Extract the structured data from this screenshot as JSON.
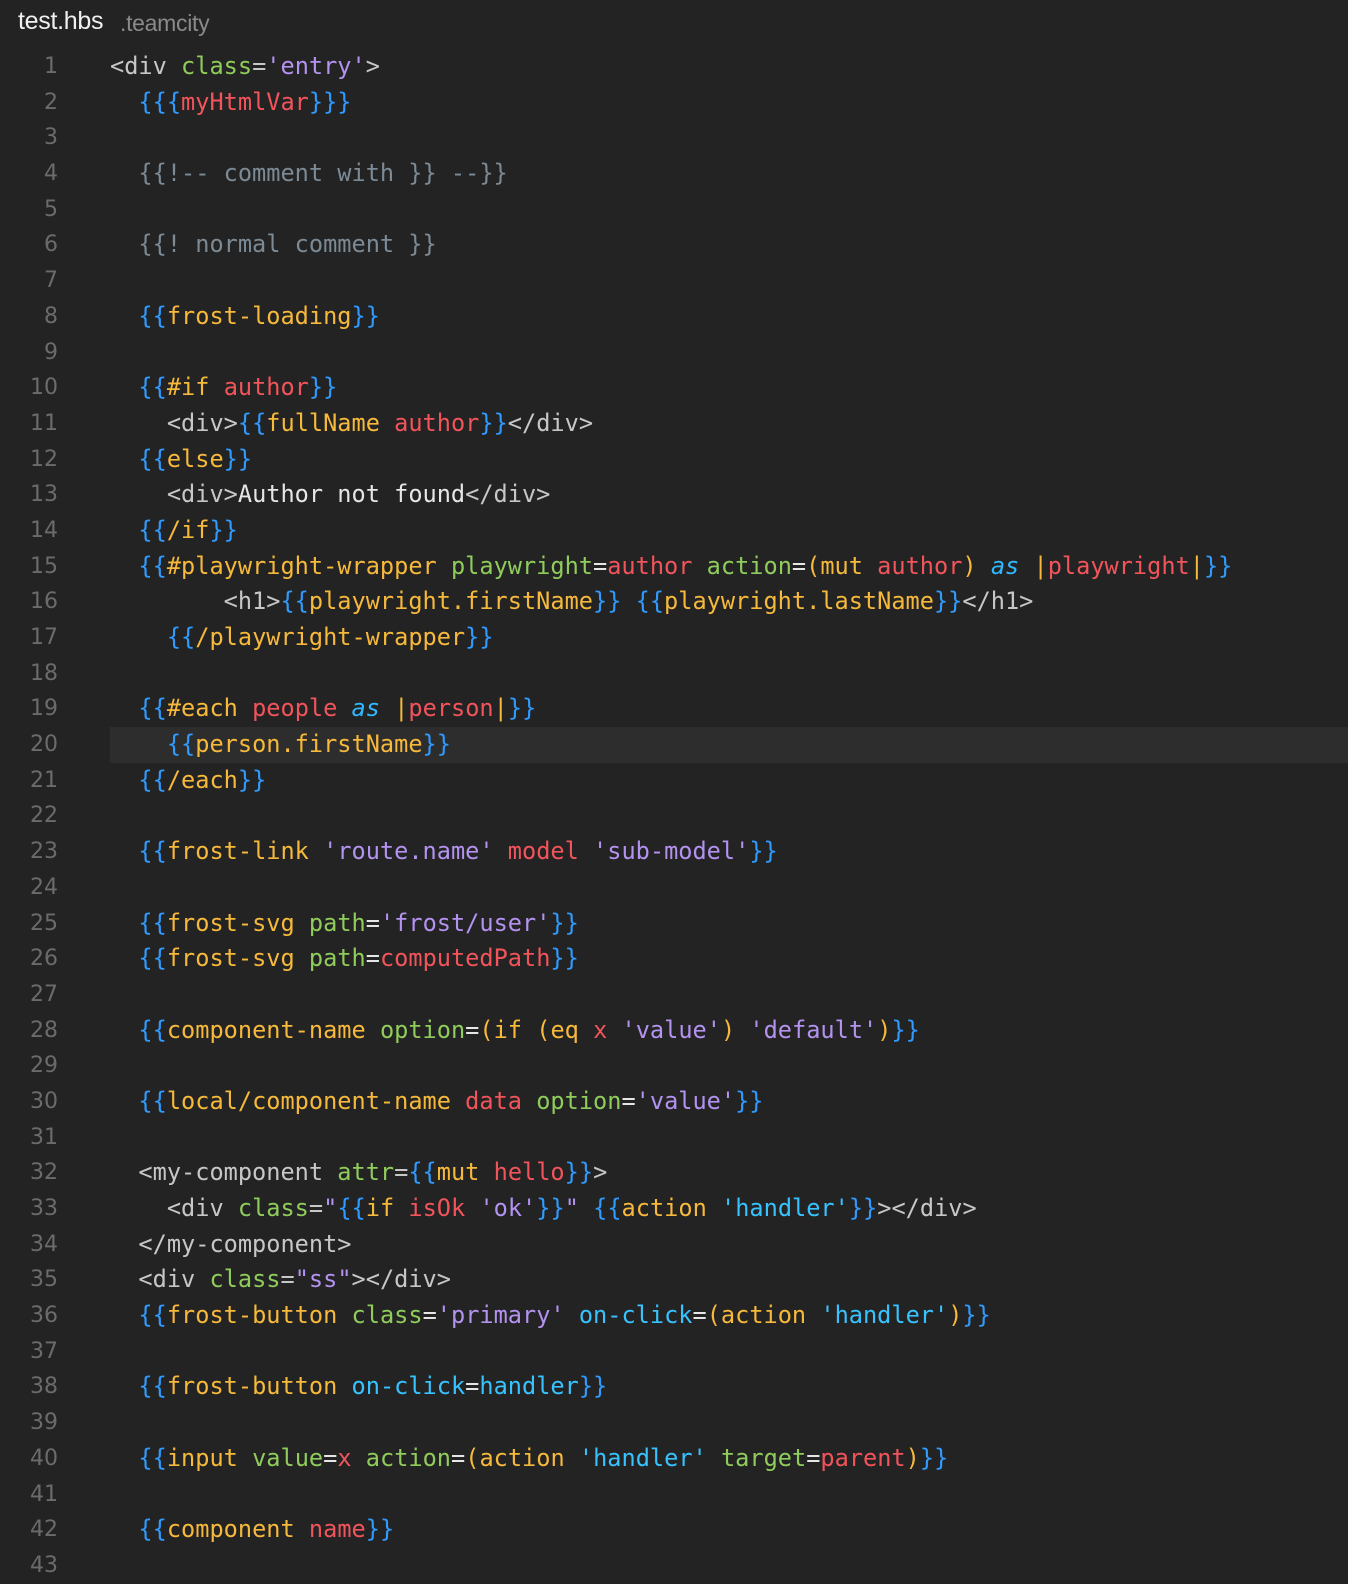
{
  "tab": {
    "filename": "test.hbs",
    "suffix": ".teamcity"
  },
  "editor": {
    "current_line": 20,
    "colors": {
      "background": "#232323",
      "line_number": "#6b6b6b",
      "current_line_highlight": "#2d2d2d",
      "brace": "#2f9bff",
      "helper": "#f6b93b",
      "attribute": "#8fcc5b",
      "variable": "#f2545b",
      "string": "#b392f0",
      "comment": "#7b8a95",
      "keyword": "#2fb8ff",
      "tag": "#c7c7c7"
    }
  },
  "lines": [
    {
      "n": "1",
      "tokens": [
        [
          "tag",
          "<div "
        ],
        [
          "attr",
          "class"
        ],
        [
          "tag",
          "="
        ],
        [
          "str",
          "'entry'"
        ],
        [
          "tag",
          ">"
        ]
      ]
    },
    {
      "n": "2",
      "tokens": [
        [
          "plain",
          "  "
        ],
        [
          "brace",
          "{{{"
        ],
        [
          "var",
          "myHtmlVar"
        ],
        [
          "brace",
          "}}}"
        ]
      ]
    },
    {
      "n": "3",
      "tokens": []
    },
    {
      "n": "4",
      "tokens": [
        [
          "plain",
          "  "
        ],
        [
          "comment",
          "{{!-- comment with }} --}}"
        ]
      ]
    },
    {
      "n": "5",
      "tokens": []
    },
    {
      "n": "6",
      "tokens": [
        [
          "plain",
          "  "
        ],
        [
          "comment",
          "{{! normal comment }}"
        ]
      ]
    },
    {
      "n": "7",
      "tokens": []
    },
    {
      "n": "8",
      "tokens": [
        [
          "plain",
          "  "
        ],
        [
          "brace",
          "{{"
        ],
        [
          "helper",
          "frost-loading"
        ],
        [
          "brace",
          "}}"
        ]
      ]
    },
    {
      "n": "9",
      "tokens": []
    },
    {
      "n": "10",
      "tokens": [
        [
          "plain",
          "  "
        ],
        [
          "brace",
          "{{"
        ],
        [
          "helper",
          "#if"
        ],
        [
          "plain",
          " "
        ],
        [
          "var",
          "author"
        ],
        [
          "brace",
          "}}"
        ]
      ]
    },
    {
      "n": "11",
      "tokens": [
        [
          "plain",
          "    "
        ],
        [
          "tag",
          "<div>"
        ],
        [
          "brace",
          "{{"
        ],
        [
          "helper",
          "fullName"
        ],
        [
          "plain",
          " "
        ],
        [
          "var",
          "author"
        ],
        [
          "brace",
          "}}"
        ],
        [
          "tag",
          "</div>"
        ]
      ]
    },
    {
      "n": "12",
      "tokens": [
        [
          "plain",
          "  "
        ],
        [
          "brace",
          "{{"
        ],
        [
          "helper",
          "else"
        ],
        [
          "brace",
          "}}"
        ]
      ]
    },
    {
      "n": "13",
      "tokens": [
        [
          "plain",
          "    "
        ],
        [
          "tag",
          "<div>"
        ],
        [
          "plain",
          "Author not found"
        ],
        [
          "tag",
          "</div>"
        ]
      ]
    },
    {
      "n": "14",
      "tokens": [
        [
          "plain",
          "  "
        ],
        [
          "brace",
          "{{"
        ],
        [
          "helper",
          "/if"
        ],
        [
          "brace",
          "}}"
        ]
      ]
    },
    {
      "n": "15",
      "tokens": [
        [
          "plain",
          "  "
        ],
        [
          "brace",
          "{{"
        ],
        [
          "helper",
          "#playwright-wrapper"
        ],
        [
          "plain",
          " "
        ],
        [
          "attr",
          "playwright"
        ],
        [
          "plain",
          "="
        ],
        [
          "var",
          "author"
        ],
        [
          "plain",
          " "
        ],
        [
          "attr",
          "action"
        ],
        [
          "plain",
          "="
        ],
        [
          "helper",
          "(mut"
        ],
        [
          "plain",
          " "
        ],
        [
          "var",
          "author"
        ],
        [
          "helper",
          ")"
        ],
        [
          "plain",
          " "
        ],
        [
          "kw",
          "as"
        ],
        [
          "plain",
          " "
        ],
        [
          "pipe",
          "|"
        ],
        [
          "var",
          "playwright"
        ],
        [
          "pipe",
          "|"
        ],
        [
          "brace",
          "}}"
        ]
      ]
    },
    {
      "n": "16",
      "tokens": [
        [
          "plain",
          "        "
        ],
        [
          "tag",
          "<h1>"
        ],
        [
          "brace",
          "{{"
        ],
        [
          "helper",
          "playwright.firstName"
        ],
        [
          "brace",
          "}}"
        ],
        [
          "plain",
          " "
        ],
        [
          "brace",
          "{{"
        ],
        [
          "helper",
          "playwright.lastName"
        ],
        [
          "brace",
          "}}"
        ],
        [
          "tag",
          "</h1>"
        ]
      ]
    },
    {
      "n": "17",
      "tokens": [
        [
          "plain",
          "    "
        ],
        [
          "brace",
          "{{"
        ],
        [
          "helper",
          "/playwright-wrapper"
        ],
        [
          "brace",
          "}}"
        ]
      ]
    },
    {
      "n": "18",
      "tokens": []
    },
    {
      "n": "19",
      "tokens": [
        [
          "plain",
          "  "
        ],
        [
          "brace",
          "{{"
        ],
        [
          "helper",
          "#each"
        ],
        [
          "plain",
          " "
        ],
        [
          "var",
          "people"
        ],
        [
          "plain",
          " "
        ],
        [
          "kw",
          "as"
        ],
        [
          "plain",
          " "
        ],
        [
          "pipe",
          "|"
        ],
        [
          "var",
          "person"
        ],
        [
          "pipe",
          "|"
        ],
        [
          "brace",
          "}}"
        ]
      ]
    },
    {
      "n": "20",
      "tokens": [
        [
          "plain",
          "    "
        ],
        [
          "brace",
          "{{"
        ],
        [
          "helper",
          "person.firstName"
        ],
        [
          "brace",
          "}}"
        ]
      ]
    },
    {
      "n": "21",
      "tokens": [
        [
          "plain",
          "  "
        ],
        [
          "brace",
          "{{"
        ],
        [
          "helper",
          "/each"
        ],
        [
          "brace",
          "}}"
        ]
      ]
    },
    {
      "n": "22",
      "tokens": []
    },
    {
      "n": "23",
      "tokens": [
        [
          "plain",
          "  "
        ],
        [
          "brace",
          "{{"
        ],
        [
          "helper",
          "frost-link"
        ],
        [
          "plain",
          " "
        ],
        [
          "str",
          "'route.name'"
        ],
        [
          "plain",
          " "
        ],
        [
          "var",
          "model"
        ],
        [
          "plain",
          " "
        ],
        [
          "str",
          "'sub-model'"
        ],
        [
          "brace",
          "}}"
        ]
      ]
    },
    {
      "n": "24",
      "tokens": []
    },
    {
      "n": "25",
      "tokens": [
        [
          "plain",
          "  "
        ],
        [
          "brace",
          "{{"
        ],
        [
          "helper",
          "frost-svg"
        ],
        [
          "plain",
          " "
        ],
        [
          "attr",
          "path"
        ],
        [
          "plain",
          "="
        ],
        [
          "str",
          "'frost/user'"
        ],
        [
          "brace",
          "}}"
        ]
      ]
    },
    {
      "n": "26",
      "tokens": [
        [
          "plain",
          "  "
        ],
        [
          "brace",
          "{{"
        ],
        [
          "helper",
          "frost-svg"
        ],
        [
          "plain",
          " "
        ],
        [
          "attr",
          "path"
        ],
        [
          "plain",
          "="
        ],
        [
          "var",
          "computedPath"
        ],
        [
          "brace",
          "}}"
        ]
      ]
    },
    {
      "n": "27",
      "tokens": []
    },
    {
      "n": "28",
      "tokens": [
        [
          "plain",
          "  "
        ],
        [
          "brace",
          "{{"
        ],
        [
          "helper",
          "component-name"
        ],
        [
          "plain",
          " "
        ],
        [
          "attr",
          "option"
        ],
        [
          "plain",
          "="
        ],
        [
          "helper",
          "(if"
        ],
        [
          "plain",
          " "
        ],
        [
          "helper",
          "(eq"
        ],
        [
          "plain",
          " "
        ],
        [
          "var",
          "x"
        ],
        [
          "plain",
          " "
        ],
        [
          "str",
          "'value'"
        ],
        [
          "helper",
          ")"
        ],
        [
          "plain",
          " "
        ],
        [
          "str",
          "'default'"
        ],
        [
          "helper",
          ")"
        ],
        [
          "brace",
          "}}"
        ]
      ]
    },
    {
      "n": "29",
      "tokens": []
    },
    {
      "n": "30",
      "tokens": [
        [
          "plain",
          "  "
        ],
        [
          "brace",
          "{{"
        ],
        [
          "helper",
          "local/component-name"
        ],
        [
          "plain",
          " "
        ],
        [
          "var",
          "data"
        ],
        [
          "plain",
          " "
        ],
        [
          "attr",
          "option"
        ],
        [
          "plain",
          "="
        ],
        [
          "str",
          "'value'"
        ],
        [
          "brace",
          "}}"
        ]
      ]
    },
    {
      "n": "31",
      "tokens": []
    },
    {
      "n": "32",
      "tokens": [
        [
          "plain",
          "  "
        ],
        [
          "tag",
          "<my-component "
        ],
        [
          "attr",
          "attr"
        ],
        [
          "tag",
          "="
        ],
        [
          "brace",
          "{{"
        ],
        [
          "helper",
          "mut"
        ],
        [
          "plain",
          " "
        ],
        [
          "var",
          "hello"
        ],
        [
          "brace",
          "}}"
        ],
        [
          "tag",
          ">"
        ]
      ]
    },
    {
      "n": "33",
      "tokens": [
        [
          "plain",
          "    "
        ],
        [
          "tag",
          "<div "
        ],
        [
          "attr",
          "class"
        ],
        [
          "tag",
          "="
        ],
        [
          "str",
          "\""
        ],
        [
          "brace",
          "{{"
        ],
        [
          "helper",
          "if"
        ],
        [
          "plain",
          " "
        ],
        [
          "var",
          "isOk"
        ],
        [
          "plain",
          " "
        ],
        [
          "str",
          "'ok'"
        ],
        [
          "brace",
          "}}"
        ],
        [
          "str",
          "\""
        ],
        [
          "plain",
          " "
        ],
        [
          "brace",
          "{{"
        ],
        [
          "helper",
          "action"
        ],
        [
          "plain",
          " "
        ],
        [
          "handler",
          "'handler'"
        ],
        [
          "brace",
          "}}"
        ],
        [
          "tag",
          "></div>"
        ]
      ]
    },
    {
      "n": "34",
      "tokens": [
        [
          "plain",
          "  "
        ],
        [
          "tag",
          "</my-component>"
        ]
      ]
    },
    {
      "n": "35",
      "tokens": [
        [
          "plain",
          "  "
        ],
        [
          "tag",
          "<div "
        ],
        [
          "attr",
          "class"
        ],
        [
          "tag",
          "="
        ],
        [
          "str",
          "\"ss\""
        ],
        [
          "tag",
          "></div>"
        ]
      ]
    },
    {
      "n": "36",
      "tokens": [
        [
          "plain",
          "  "
        ],
        [
          "brace",
          "{{"
        ],
        [
          "helper",
          "frost-button"
        ],
        [
          "plain",
          " "
        ],
        [
          "attr",
          "class"
        ],
        [
          "plain",
          "="
        ],
        [
          "str",
          "'primary'"
        ],
        [
          "plain",
          " "
        ],
        [
          "handler",
          "on-click"
        ],
        [
          "plain",
          "="
        ],
        [
          "helper",
          "(action"
        ],
        [
          "plain",
          " "
        ],
        [
          "handler",
          "'handler'"
        ],
        [
          "helper",
          ")"
        ],
        [
          "brace",
          "}}"
        ]
      ]
    },
    {
      "n": "37",
      "tokens": []
    },
    {
      "n": "38",
      "tokens": [
        [
          "plain",
          "  "
        ],
        [
          "brace",
          "{{"
        ],
        [
          "helper",
          "frost-button"
        ],
        [
          "plain",
          " "
        ],
        [
          "handler",
          "on-click"
        ],
        [
          "plain",
          "="
        ],
        [
          "handler",
          "handler"
        ],
        [
          "brace",
          "}}"
        ]
      ]
    },
    {
      "n": "39",
      "tokens": []
    },
    {
      "n": "40",
      "tokens": [
        [
          "plain",
          "  "
        ],
        [
          "brace",
          "{{"
        ],
        [
          "helper",
          "input"
        ],
        [
          "plain",
          " "
        ],
        [
          "attr",
          "value"
        ],
        [
          "plain",
          "="
        ],
        [
          "var",
          "x"
        ],
        [
          "plain",
          " "
        ],
        [
          "attr",
          "action"
        ],
        [
          "plain",
          "="
        ],
        [
          "helper",
          "(action"
        ],
        [
          "plain",
          " "
        ],
        [
          "handler",
          "'handler'"
        ],
        [
          "plain",
          " "
        ],
        [
          "attr",
          "target"
        ],
        [
          "plain",
          "="
        ],
        [
          "var",
          "parent"
        ],
        [
          "helper",
          ")"
        ],
        [
          "brace",
          "}}"
        ]
      ]
    },
    {
      "n": "41",
      "tokens": []
    },
    {
      "n": "42",
      "tokens": [
        [
          "plain",
          "  "
        ],
        [
          "brace",
          "{{"
        ],
        [
          "helper",
          "component"
        ],
        [
          "plain",
          " "
        ],
        [
          "var",
          "name"
        ],
        [
          "brace",
          "}}"
        ]
      ]
    },
    {
      "n": "43",
      "tokens": []
    }
  ]
}
